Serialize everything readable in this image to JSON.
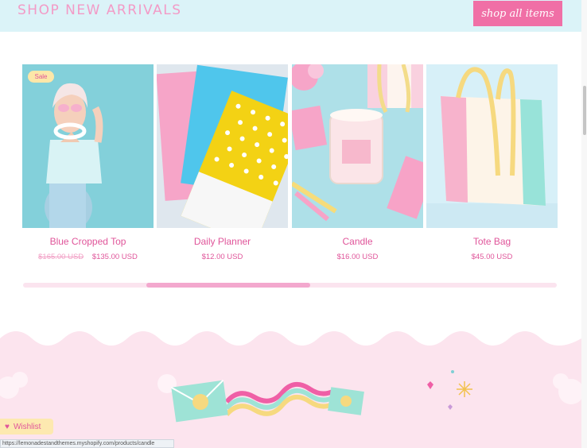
{
  "header": {
    "title": "SHOP NEW ARRIVALS",
    "shop_all_label": "shop all items"
  },
  "products": [
    {
      "title": "Blue Cropped Top",
      "old_price": "$165.00 USD",
      "price": "$135.00 USD",
      "badge": "Sale"
    },
    {
      "title": "Daily Planner",
      "price": "$12.00 USD"
    },
    {
      "title": "Candle",
      "price": "$16.00 USD"
    },
    {
      "title": "Tote Bag",
      "price": "$45.00 USD"
    }
  ],
  "carousel": {
    "progress": 0.31
  },
  "wishlist": {
    "label": "Wishlist"
  },
  "status_bar": {
    "url": "https://lemonadestandthemes.myshopify.com/products/candle"
  },
  "colors": {
    "accent": "#f06fa6",
    "header_bg": "#dbf3f8",
    "text_pink": "#e0559a"
  },
  "icons": [
    "heart-icon",
    "sparkle-icon",
    "envelope-icon"
  ]
}
